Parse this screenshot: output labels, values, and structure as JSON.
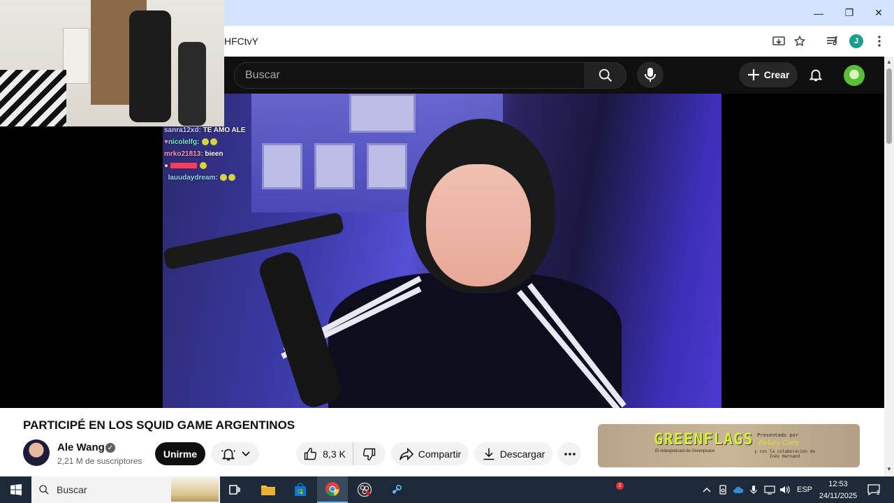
{
  "browser": {
    "url_fragment": "HFCtvY",
    "profile_initial": "J",
    "window_controls": {
      "minimize": "—",
      "restore": "❐",
      "close": "✕"
    }
  },
  "header": {
    "search_placeholder": "Buscar",
    "create_label": "Crear"
  },
  "chat": {
    "lines": [
      {
        "user": "sanra12xd:",
        "message": "TE AMO ALE",
        "user_color": "#c8c8ff"
      },
      {
        "user": "nicolelfg:",
        "message": "",
        "user_color": "#7cf2d2"
      },
      {
        "user": "mrko21813:",
        "message": "bieen",
        "user_color": "#ff9ac4"
      },
      {
        "user": "",
        "message": "",
        "user_color": "#ff3c5a"
      },
      {
        "user": "lauudaydream:",
        "message": "",
        "user_color": "#9ad7ff"
      }
    ]
  },
  "video": {
    "title": "PARTICIPÉ EN LOS SQUID GAME ARGENTINOS",
    "channel_name": "Ale Wang",
    "subscribers": "2,21 M de suscriptores",
    "join_label": "Unirme",
    "likes": "8,3 K",
    "share_label": "Compartir",
    "download_label": "Descargar"
  },
  "ad": {
    "title": "GREENFLAGS",
    "subtitle": "El videopodcast de Greenpeace",
    "presented": "Presentado por",
    "sponsor": "Bekey Cors",
    "collab": "y con la colaboración de Inés Hernand"
  },
  "taskbar": {
    "search_placeholder": "Buscar",
    "badge_count": "2",
    "language": "ESP",
    "time": "12:53",
    "date": "24/11/2025",
    "notification_count": "1"
  },
  "colors": {
    "youtube_bg": "#0f0f0f",
    "titlebar": "#d3e3fd",
    "taskbar": "#1f2a38"
  }
}
